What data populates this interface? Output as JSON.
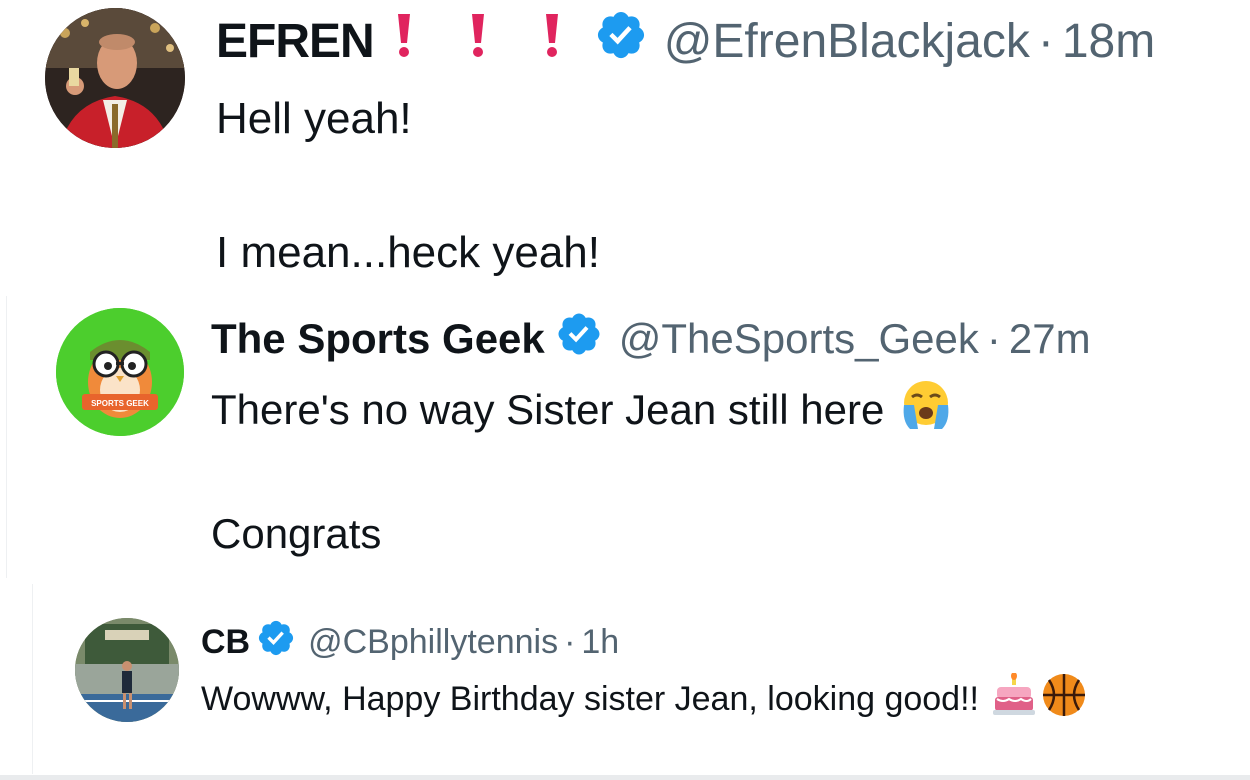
{
  "tweets": [
    {
      "name": "EFREN",
      "handle": "@EfrenBlackjack",
      "separator": "·",
      "time": "18m",
      "text_line1": "Hell yeah!",
      "text_line2": "I mean...heck yeah!"
    },
    {
      "name": "The Sports Geek",
      "handle": "@TheSports_Geek",
      "separator": "·",
      "time": "27m",
      "text_line1": "There's no way Sister Jean still here",
      "text_line2": "Congrats",
      "avatar_text": "SPORTS GEEK"
    },
    {
      "name": "CB",
      "handle": "@CBphillytennis",
      "separator": "·",
      "time": "1h",
      "text_line1": "Wowww, Happy Birthday sister Jean, looking good!!"
    }
  ],
  "colors": {
    "verified_blue": "#1d9bf0",
    "handle_gray": "#536471",
    "exclamation_red": "#e0245e",
    "sports_geek_green": "#4cce2d"
  },
  "icons": [
    "verified-badge-icon",
    "red-exclamation-icon",
    "crying-face-emoji",
    "birthday-cake-emoji",
    "basketball-emoji"
  ]
}
